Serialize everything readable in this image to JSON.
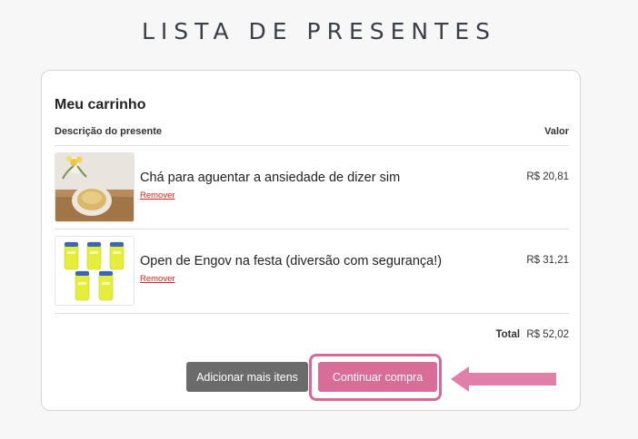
{
  "page": {
    "title": "LISTA DE PRESENTES"
  },
  "cart": {
    "title": "Meu carrinho",
    "columns": {
      "description": "Descrição do presente",
      "value": "Valor"
    },
    "items": [
      {
        "name": "Chá para aguentar a ansiedade de dizer sim",
        "remove_label": "Remover",
        "price": "R$ 20,81",
        "image": "tea-cup-photo"
      },
      {
        "name": "Open de Engov na festa (diversão com segurança!)",
        "remove_label": "Remover",
        "price": "R$ 31,21",
        "image": "engov-bottles-photo"
      }
    ],
    "total_label": "Total",
    "total_value": "R$ 52,02"
  },
  "actions": {
    "add_more_label": "Adicionar mais itens",
    "continue_label": "Continuar compra"
  },
  "colors": {
    "accent_pink": "#d86e98",
    "button_gray": "#6b6b6b",
    "remove_red": "#dd2222"
  }
}
